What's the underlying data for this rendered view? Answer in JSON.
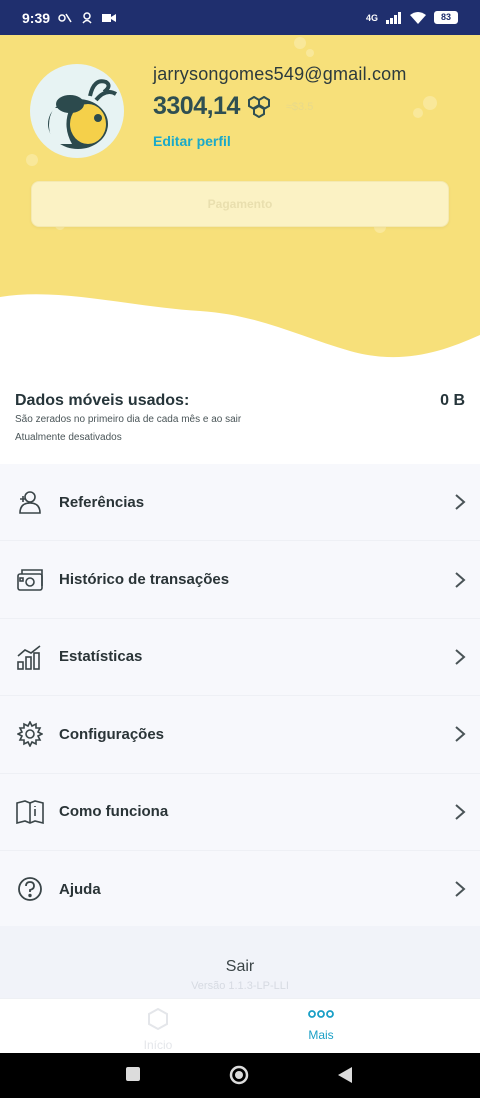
{
  "status_bar": {
    "time": "9:39",
    "network": "4G",
    "battery": "83"
  },
  "profile": {
    "email": "jarrysongomes549@gmail.com",
    "balance": "3304,14",
    "balance_unit": "≈$3.5",
    "edit_label": "Editar perfil",
    "payment_label": "Pagamento"
  },
  "data_usage": {
    "title": "Dados móveis usados:",
    "value": "0 B",
    "note": "São zerados no primeiro dia de cada mês e ao sair",
    "status": "Atualmente desativados"
  },
  "menu": {
    "items": [
      {
        "label": "Referências",
        "icon": "referrals-icon"
      },
      {
        "label": "Histórico de transações",
        "icon": "wallet-icon"
      },
      {
        "label": "Estatísticas",
        "icon": "chart-icon"
      },
      {
        "label": "Configurações",
        "icon": "gear-icon"
      },
      {
        "label": "Como funciona",
        "icon": "book-icon"
      },
      {
        "label": "Ajuda",
        "icon": "help-icon"
      }
    ]
  },
  "footer": {
    "logout_label": "Sair",
    "version": "Versão 1.1.3-LP-LLI"
  },
  "bottom_nav": {
    "home_label": "Início",
    "more_label": "Mais"
  },
  "colors": {
    "header_yellow": "#f7e07a",
    "accent": "#1a9fc6",
    "status_bar": "#1f2f6e"
  }
}
